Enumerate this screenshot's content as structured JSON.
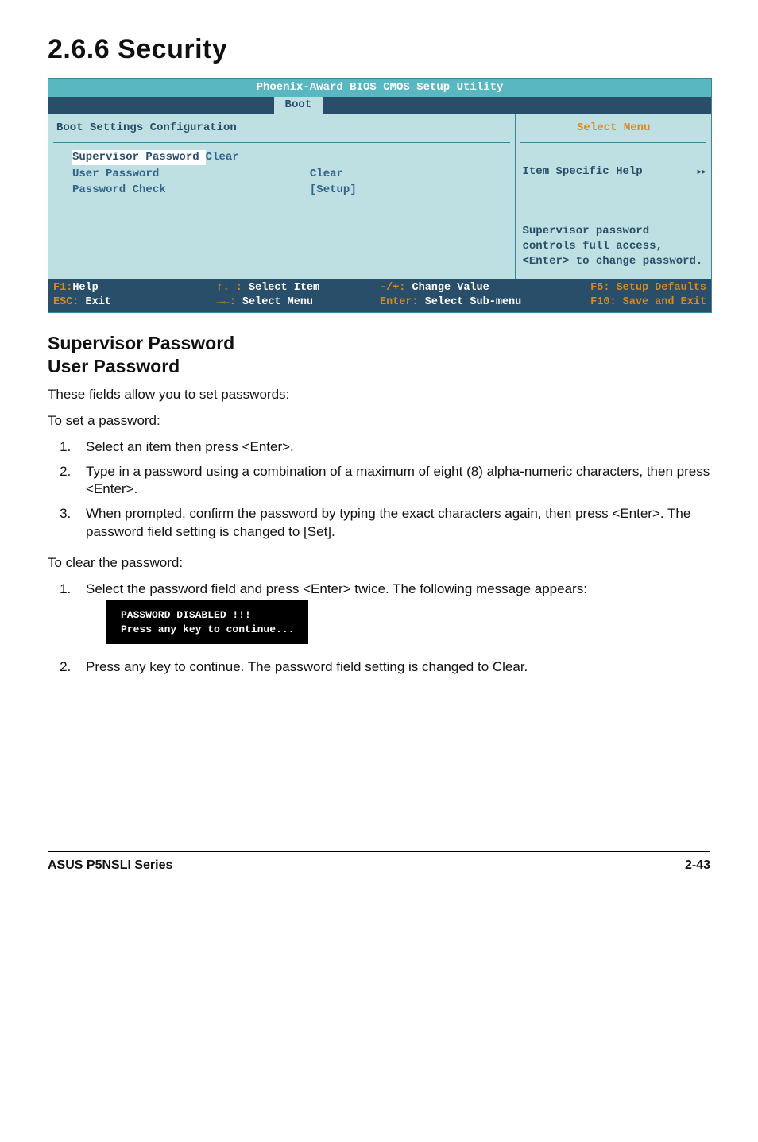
{
  "heading": "2.6.6   Security",
  "bios": {
    "title": "Phoenix-Award BIOS CMOS Setup Utility",
    "tab": "Boot",
    "left_panel_title": "Boot Settings Configuration",
    "rows": [
      {
        "label": "Supervisor Password",
        "value": "Clear",
        "selected": true
      },
      {
        "label": "User Password",
        "value": "Clear",
        "selected": false
      },
      {
        "label": "Password Check",
        "value": "[Setup]",
        "selected": false
      }
    ],
    "side_title": "Select Menu",
    "side_help_first": "Item Specific Help",
    "side_help_glyph": "▸▸",
    "side_help_rest": "Supervisor password controls full access, <Enter> to change password.",
    "footer": {
      "l1a_k": "F1:",
      "l1a_t": "Help",
      "l1b_k": "↑↓ :",
      "l1b_t": " Select Item",
      "l1c_k": "-/+:",
      "l1c_t": " Change Value",
      "l1d": "F5: Setup Defaults",
      "l2a_k": "ESC:",
      "l2a_t": " Exit",
      "l2b_k": "→←:",
      "l2b_t": " Select Menu",
      "l2c_k": "Enter:",
      "l2c_t": " Select Sub-menu",
      "l2d": "F10: Save and Exit"
    }
  },
  "subheading1": "Supervisor Password",
  "subheading2": "User Password",
  "intro": "These fields allow you to set passwords:",
  "set_label": "To set a password:",
  "set_steps": [
    "Select an item then press <Enter>.",
    "Type in a password using a combination of a maximum of eight (8) alpha-numeric characters, then press <Enter>.",
    "When prompted, confirm the password by typing the exact characters again, then press <Enter>. The password field setting is changed to [Set]."
  ],
  "clear_label": "To clear the password:",
  "clear_step1": "Select the password field and press <Enter> twice. The following message appears:",
  "codebox_line1": "PASSWORD DISABLED !!!",
  "codebox_line2": "Press any key to continue...",
  "clear_step2": "Press any key to continue. The password field setting is changed to Clear.",
  "footer_left": "ASUS P5NSLI Series",
  "footer_right": "2-43"
}
